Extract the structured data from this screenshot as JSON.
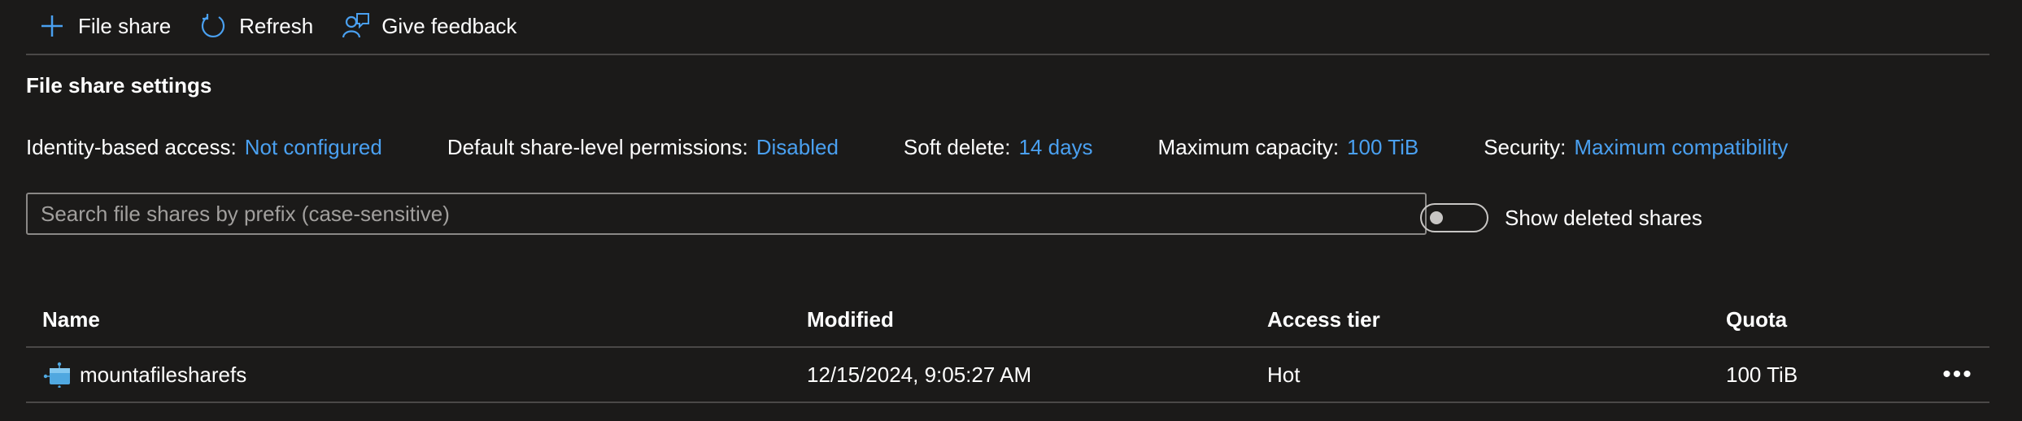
{
  "toolbar": {
    "file_share_label": "File share",
    "refresh_label": "Refresh",
    "feedback_label": "Give feedback"
  },
  "settings": {
    "title": "File share settings",
    "items": [
      {
        "key": "Identity-based access:",
        "value": "Not configured"
      },
      {
        "key": "Default share-level permissions:",
        "value": "Disabled"
      },
      {
        "key": "Soft delete:",
        "value": "14 days"
      },
      {
        "key": "Maximum capacity:",
        "value": "100 TiB"
      },
      {
        "key": "Security:",
        "value": "Maximum compatibility"
      }
    ]
  },
  "search": {
    "placeholder": "Search file shares by prefix (case-sensitive)",
    "value": ""
  },
  "toggle": {
    "label": "Show deleted shares",
    "on": false
  },
  "table": {
    "headers": {
      "name": "Name",
      "modified": "Modified",
      "tier": "Access tier",
      "quota": "Quota"
    },
    "rows": [
      {
        "name": "mountafilesharefs",
        "modified": "12/15/2024, 9:05:27 AM",
        "tier": "Hot",
        "quota": "100 TiB",
        "more": "•••"
      }
    ]
  },
  "colors": {
    "background": "#1b1a19",
    "link": "#4aa0f0",
    "accent_icon": "#4aa0f0"
  },
  "icons": [
    "plus-icon",
    "refresh-icon",
    "feedback-icon",
    "file-share-icon",
    "more-icon"
  ]
}
